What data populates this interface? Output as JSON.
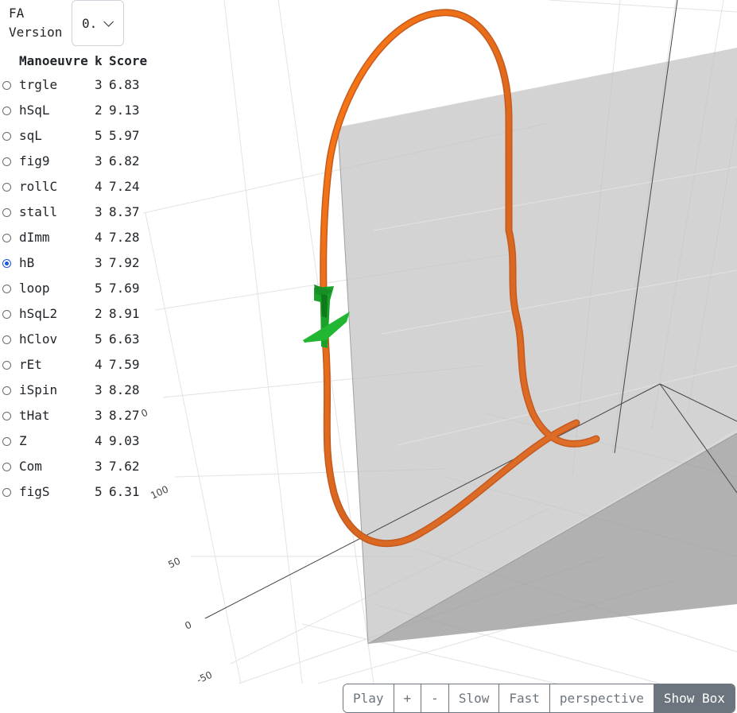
{
  "fa_version": {
    "label": "FA Version",
    "value": "0."
  },
  "table": {
    "headers": [
      "Manoeuvre",
      "k",
      "Score"
    ],
    "rows": [
      {
        "name": "trgle",
        "k": "3",
        "score": "6.83",
        "selected": false
      },
      {
        "name": "hSqL",
        "k": "2",
        "score": "9.13",
        "selected": false
      },
      {
        "name": "sqL",
        "k": "5",
        "score": "5.97",
        "selected": false
      },
      {
        "name": "fig9",
        "k": "3",
        "score": "6.82",
        "selected": false
      },
      {
        "name": "rollC",
        "k": "4",
        "score": "7.24",
        "selected": false
      },
      {
        "name": "stall",
        "k": "3",
        "score": "8.37",
        "selected": false
      },
      {
        "name": "dImm",
        "k": "4",
        "score": "7.28",
        "selected": false
      },
      {
        "name": "hB",
        "k": "3",
        "score": "7.92",
        "selected": true
      },
      {
        "name": "loop",
        "k": "5",
        "score": "7.69",
        "selected": false
      },
      {
        "name": "hSqL2",
        "k": "2",
        "score": "8.91",
        "selected": false
      },
      {
        "name": "hClov",
        "k": "5",
        "score": "6.63",
        "selected": false
      },
      {
        "name": "rEt",
        "k": "4",
        "score": "7.59",
        "selected": false
      },
      {
        "name": "iSpin",
        "k": "3",
        "score": "8.28",
        "selected": false
      },
      {
        "name": "tHat",
        "k": "3",
        "score": "8.27",
        "selected": false
      },
      {
        "name": "Z",
        "k": "4",
        "score": "9.03",
        "selected": false
      },
      {
        "name": "Com",
        "k": "3",
        "score": "7.62",
        "selected": false
      },
      {
        "name": "figS",
        "k": "5",
        "score": "6.31",
        "selected": false
      }
    ]
  },
  "axis_ticks": [
    "-50",
    "0",
    "50",
    "100",
    "0"
  ],
  "controls": {
    "play": "Play",
    "plus": "+",
    "minus": "-",
    "slow": "Slow",
    "fast": "Fast",
    "perspective": "perspective",
    "show_box": "Show Box"
  },
  "colors": {
    "flight_path": "#e8651a",
    "aircraft": "#1faa2e",
    "box": "#b9b9b9",
    "selected_radio": "#1a55e3"
  },
  "icons": {
    "select_chevron": "chevron-down-icon",
    "aircraft": "aircraft-icon"
  }
}
